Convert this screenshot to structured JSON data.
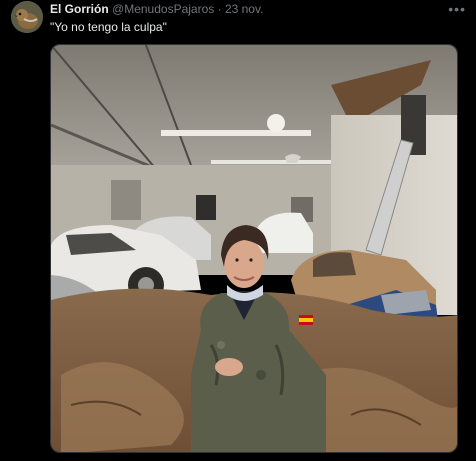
{
  "tweet": {
    "author_name": "El Gorrión",
    "handle": "@MenudosPajaros",
    "separator": "·",
    "date": "23 nov.",
    "text": "\"Yo no tengo la culpa\"",
    "more_icon": "more-horizontal-icon"
  },
  "media": {
    "flag_color_red": "#c60b1e",
    "flag_color_yellow": "#ffc400"
  }
}
